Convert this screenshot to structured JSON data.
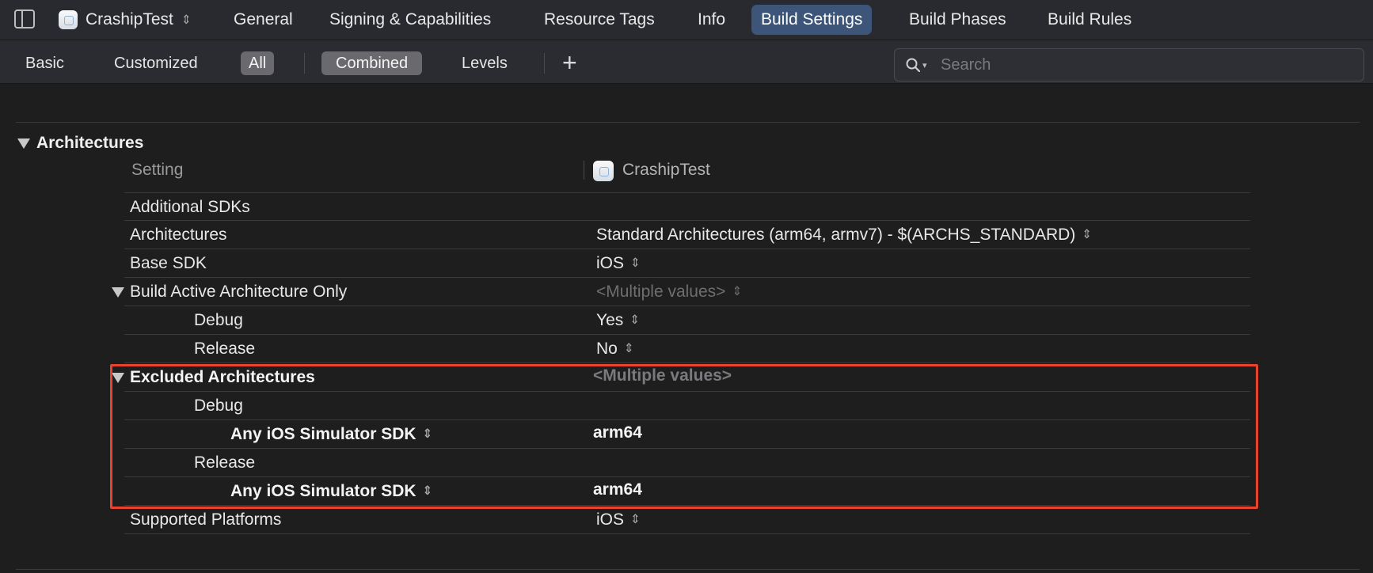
{
  "top_tabs": {
    "target_name": "CrashipTest",
    "updown_glyph": "⌃⌄",
    "tabs": [
      "General",
      "Signing & Capabilities",
      "Resource Tags",
      "Info",
      "Build Settings",
      "Build Phases",
      "Build Rules"
    ],
    "active_tab": "Build Settings"
  },
  "filter_bar": {
    "basic": "Basic",
    "customized": "Customized",
    "all": "All",
    "combined": "Combined",
    "levels": "Levels",
    "plus": "+",
    "search_placeholder": "Search"
  },
  "section": {
    "title": "Architectures",
    "col_setting": "Setting",
    "col_target": "CrashipTest"
  },
  "rows": [
    {
      "label": "Additional SDKs",
      "value": ""
    },
    {
      "label": "Architectures",
      "value": "Standard Architectures (arm64, armv7)  -  $(ARCHS_STANDARD)"
    },
    {
      "label": "Base SDK",
      "value": "iOS"
    },
    {
      "label": "Build Active Architecture Only",
      "value": "<Multiple values>"
    },
    {
      "label": "Debug",
      "value": "Yes"
    },
    {
      "label": "Release",
      "value": "No"
    },
    {
      "label": "Excluded Architectures",
      "value": "<Multiple values>"
    },
    {
      "label": "Debug",
      "value": ""
    },
    {
      "label": "Any iOS Simulator SDK",
      "value": "arm64"
    },
    {
      "label": "Release",
      "value": ""
    },
    {
      "label": "Any iOS Simulator SDK",
      "value": "arm64"
    },
    {
      "label": "Supported Platforms",
      "value": "iOS"
    }
  ],
  "colors": {
    "active_tab": "#3d5579",
    "highlight": "#e8432e",
    "background": "#1e1e1e"
  }
}
